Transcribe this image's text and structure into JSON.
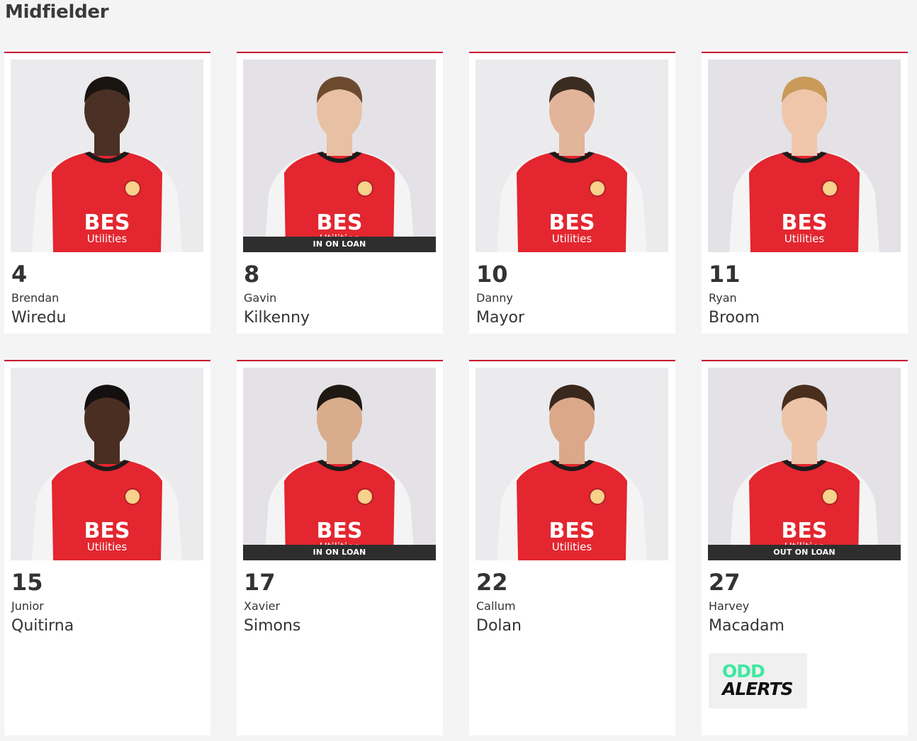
{
  "section": {
    "title": "Midfielder"
  },
  "players": [
    {
      "number": "4",
      "first_name": "Brendan",
      "last_name": "Wiredu",
      "badge": "",
      "skin": "#4a3024",
      "hair": "#1a1410"
    },
    {
      "number": "8",
      "first_name": "Gavin",
      "last_name": "Kilkenny",
      "badge": "IN ON LOAN",
      "skin": "#e8c0a4",
      "hair": "#6b4a2e"
    },
    {
      "number": "10",
      "first_name": "Danny",
      "last_name": "Mayor",
      "badge": "",
      "skin": "#e2b49a",
      "hair": "#3b2c22"
    },
    {
      "number": "11",
      "first_name": "Ryan",
      "last_name": "Broom",
      "badge": "",
      "skin": "#efc6aa",
      "hair": "#c99a5a"
    },
    {
      "number": "15",
      "first_name": "Junior",
      "last_name": "Quitirna",
      "badge": "",
      "skin": "#4b2e22",
      "hair": "#141010"
    },
    {
      "number": "17",
      "first_name": "Xavier",
      "last_name": "Simons",
      "badge": "IN ON LOAN",
      "skin": "#d9ac8c",
      "hair": "#201812"
    },
    {
      "number": "22",
      "first_name": "Callum",
      "last_name": "Dolan",
      "badge": "",
      "skin": "#dba88a",
      "hair": "#3a281c"
    },
    {
      "number": "27",
      "first_name": "Harvey",
      "last_name": "Macadam",
      "badge": "OUT ON LOAN",
      "skin": "#edc4a8",
      "hair": "#4a2e1e"
    }
  ],
  "sponsor": {
    "line1": "ODD",
    "line2": "ALERTS"
  },
  "colors": {
    "accent": "#c8102e",
    "shirt_red": "#e3262f",
    "badge_bg": "#2e2e2e",
    "page_bg": "#f4f4f4"
  },
  "kit": {
    "sponsor_line1": "BES",
    "sponsor_line2": "Utilities"
  }
}
